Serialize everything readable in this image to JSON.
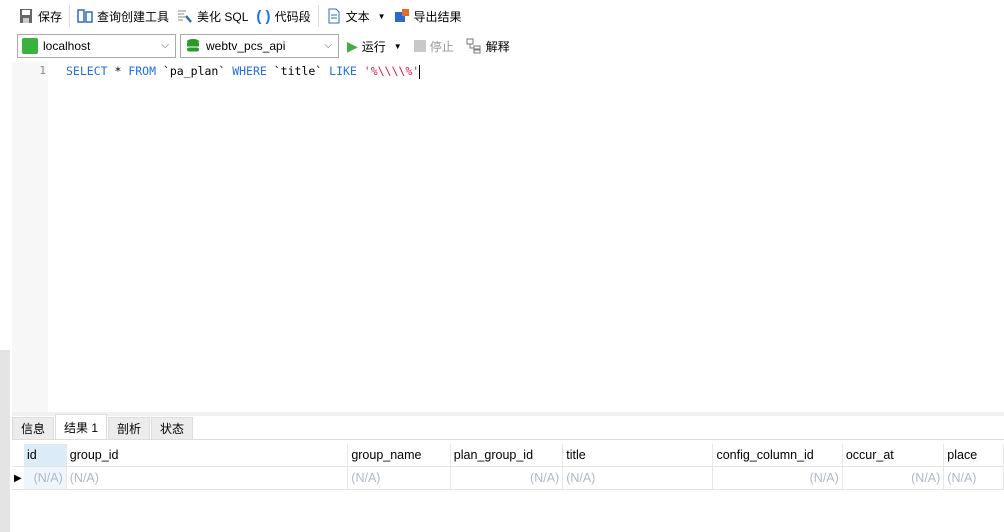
{
  "toolbar1": {
    "save": "保存",
    "query_builder": "查询创建工具",
    "beautify": "美化 SQL",
    "snippet": "代码段",
    "text": "文本",
    "export": "导出结果"
  },
  "toolbar2": {
    "connection": "localhost",
    "database": "webtv_pcs_api",
    "run": "运行",
    "stop": "停止",
    "explain": "解释"
  },
  "editor": {
    "line": "1",
    "sql": {
      "k1": "SELECT",
      "t1": " * ",
      "k2": "FROM",
      "t2": " `pa_plan` ",
      "k3": "WHERE",
      "t3": " `title` ",
      "k4": "LIKE",
      "t4": " ",
      "s": "'%\\\\\\\\%'"
    }
  },
  "tabs": [
    "信息",
    "结果 1",
    "剖析",
    "状态"
  ],
  "grid": {
    "columns": [
      "id",
      "group_id",
      "group_name",
      "plan_group_id",
      "title",
      "config_column_id",
      "occur_at",
      "place"
    ],
    "row": [
      "(N/A)",
      "(N/A)",
      "(N/A)",
      "(N/A)",
      "(N/A)",
      "(N/A)",
      "(N/A)",
      "(N/A)"
    ]
  },
  "colors": {
    "keyword": "#1e6ff0",
    "string": "#e0204a",
    "run": "#3cb23c"
  }
}
